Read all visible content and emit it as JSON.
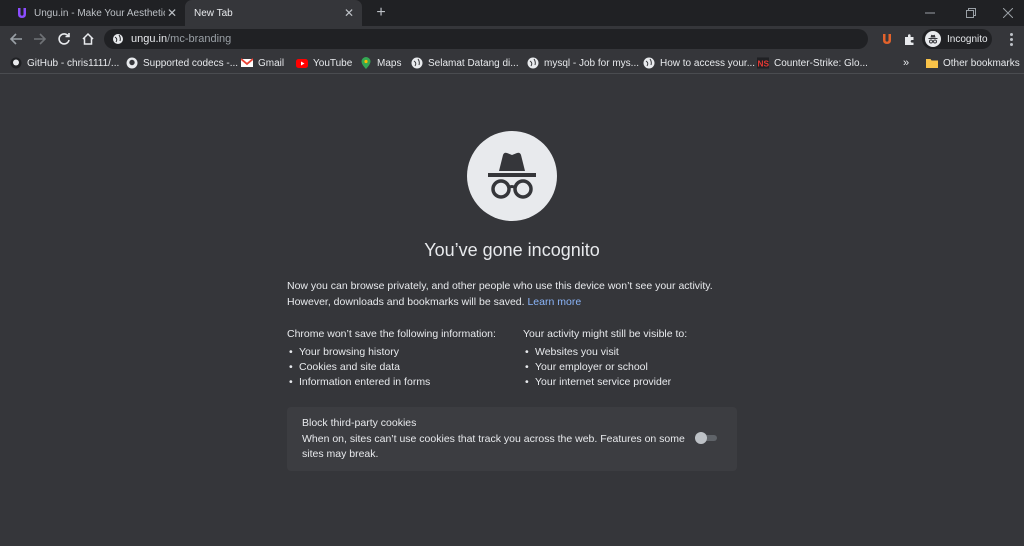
{
  "tabs": [
    {
      "title": "Ungu.in - Make Your Aesthetic U",
      "active": false,
      "favicon": "ungu-logo-icon"
    },
    {
      "title": "New Tab",
      "active": true
    }
  ],
  "toolbar": {
    "url_host": "ungu.in",
    "url_path": "/mc-branding",
    "profile_label": "Incognito"
  },
  "bookmarks": [
    {
      "label": "GitHub - chris1111/...",
      "icon": "github-icon"
    },
    {
      "label": "Supported codecs -...",
      "icon": "github-icon"
    },
    {
      "label": "Gmail",
      "icon": "gmail-icon"
    },
    {
      "label": "YouTube",
      "icon": "youtube-icon"
    },
    {
      "label": "Maps",
      "icon": "maps-icon"
    },
    {
      "label": "Selamat Datang di...",
      "icon": "globe-icon"
    },
    {
      "label": "mysql - Job for mys...",
      "icon": "globe-icon"
    },
    {
      "label": "How to access your...",
      "icon": "globe-icon"
    },
    {
      "label": "Counter-Strike: Glo...",
      "icon": "ns-icon"
    }
  ],
  "bookmarks_overflow": "»",
  "other_bookmarks": "Other bookmarks",
  "page": {
    "heading": "You’ve gone incognito",
    "intro_line1": "Now you can browse privately, and other people who use this device won’t see your activity.",
    "intro_line2": "However, downloads and bookmarks will be saved.",
    "learn_more": "Learn more",
    "not_saved_heading": "Chrome won’t save the following information:",
    "not_saved_items": [
      "Your browsing history",
      "Cookies and site data",
      "Information entered in forms"
    ],
    "visible_heading": "Your activity might still be visible to:",
    "visible_items": [
      "Websites you visit",
      "Your employer or school",
      "Your internet service provider"
    ],
    "cookies_title": "Block third-party cookies",
    "cookies_desc": "When on, sites can’t use cookies that track you across the web. Features on some sites may break.",
    "cookies_toggle_on": false
  },
  "colors": {
    "page_bg": "#35363a",
    "tabstrip_bg": "#202124",
    "link": "#8ab4f8",
    "card_bg": "#3c3d41"
  }
}
